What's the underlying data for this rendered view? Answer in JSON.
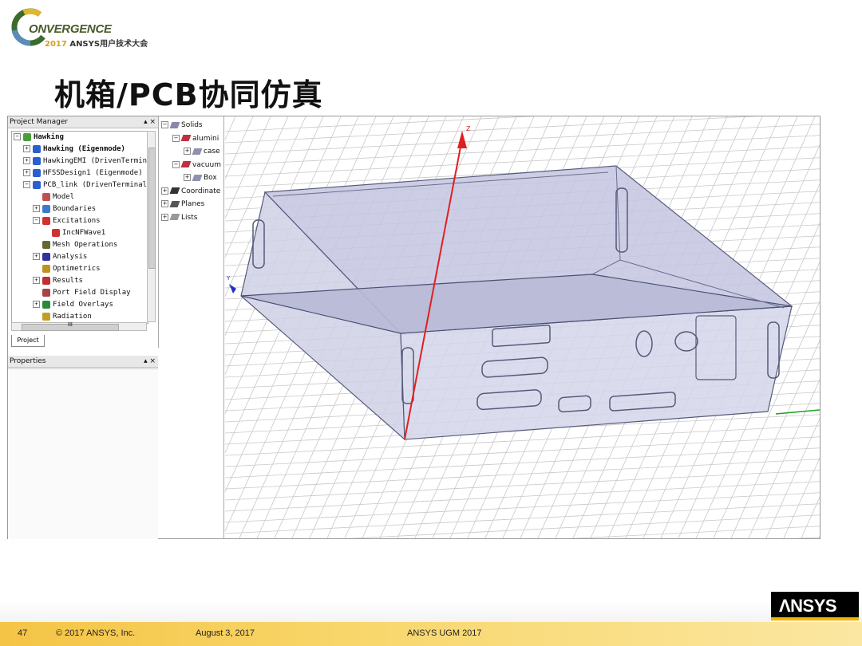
{
  "logo": {
    "word": "ONVERGENCE",
    "year": "2017",
    "event": " ANSYS用户技术大会"
  },
  "slide": {
    "title": "机箱/PCB协同仿真"
  },
  "project_manager": {
    "title": "Project Manager",
    "controls": "▴ ×",
    "tree": [
      {
        "label": "Hawking",
        "indent": 0,
        "bold": true,
        "expander": "−",
        "icon": "project-icon",
        "color": "#4a9e3a"
      },
      {
        "label": "Hawking (Eigenmode)",
        "indent": 1,
        "bold": true,
        "expander": "+",
        "icon": "hfss-design-icon",
        "color": "#2b5fd0"
      },
      {
        "label": "HawkingEMI (DrivenTerminal)",
        "indent": 1,
        "bold": false,
        "expander": "+",
        "icon": "hfss-design-icon",
        "color": "#2b5fd0"
      },
      {
        "label": "HFSSDesign1 (Eigenmode)",
        "indent": 1,
        "bold": false,
        "expander": "+",
        "icon": "hfss-design-icon",
        "color": "#2b5fd0"
      },
      {
        "label": "PCB_link (DrivenTerminal)",
        "indent": 1,
        "bold": false,
        "expander": "−",
        "icon": "hfss-design-icon",
        "color": "#2b5fd0"
      },
      {
        "label": "Model",
        "indent": 2,
        "bold": false,
        "expander": "",
        "icon": "model-icon",
        "color": "#c05050"
      },
      {
        "label": "Boundaries",
        "indent": 2,
        "bold": false,
        "expander": "+",
        "icon": "boundaries-icon",
        "color": "#3a7ad0"
      },
      {
        "label": "Excitations",
        "indent": 2,
        "bold": false,
        "expander": "−",
        "icon": "excitations-icon",
        "color": "#d03030"
      },
      {
        "label": "IncNFWave1",
        "indent": 3,
        "bold": false,
        "expander": "",
        "icon": "wave-icon",
        "color": "#d03030"
      },
      {
        "label": "Mesh Operations",
        "indent": 2,
        "bold": false,
        "expander": "",
        "icon": "mesh-icon",
        "color": "#666633"
      },
      {
        "label": "Analysis",
        "indent": 2,
        "bold": false,
        "expander": "+",
        "icon": "analysis-icon",
        "color": "#333399"
      },
      {
        "label": "Optimetrics",
        "indent": 2,
        "bold": false,
        "expander": "",
        "icon": "optimetrics-icon",
        "color": "#c09020"
      },
      {
        "label": "Results",
        "indent": 2,
        "bold": false,
        "expander": "+",
        "icon": "results-icon",
        "color": "#c03030"
      },
      {
        "label": "Port Field Display",
        "indent": 2,
        "bold": false,
        "expander": "",
        "icon": "port-field-icon",
        "color": "#aa4444"
      },
      {
        "label": "Field Overlays",
        "indent": 2,
        "bold": false,
        "expander": "+",
        "icon": "field-overlays-icon",
        "color": "#2a8a3a"
      },
      {
        "label": "Radiation",
        "indent": 2,
        "bold": false,
        "expander": "",
        "icon": "radiation-icon",
        "color": "#c0a020"
      }
    ],
    "hscroll_label": "III",
    "tab": "Project"
  },
  "properties": {
    "title": "Properties",
    "controls": "▴ ×"
  },
  "model_tree": [
    {
      "label": "Solids",
      "indent": 0,
      "expander": "−",
      "icon": "solids-icon"
    },
    {
      "label": "alumini",
      "indent": 1,
      "expander": "−",
      "icon": "material-icon"
    },
    {
      "label": "case",
      "indent": 2,
      "expander": "+",
      "icon": "object-icon"
    },
    {
      "label": "vacuum",
      "indent": 1,
      "expander": "−",
      "icon": "material-icon"
    },
    {
      "label": "Box",
      "indent": 2,
      "expander": "+",
      "icon": "object-icon"
    },
    {
      "label": "Coordinate",
      "indent": 0,
      "expander": "+",
      "icon": "coordinate-icon"
    },
    {
      "label": "Planes",
      "indent": 0,
      "expander": "+",
      "icon": "planes-icon"
    },
    {
      "label": "Lists",
      "indent": 0,
      "expander": "+",
      "icon": "lists-icon"
    }
  ],
  "viewport": {
    "axis_z": "Z",
    "axis_y": "Y",
    "grid_color": "#c8c8c8",
    "box_fill": "#b8bcd8",
    "z_color": "#e02020",
    "y_color": "#2030c0",
    "x_color": "#20a020"
  },
  "footer": {
    "page": "47",
    "copyright": "© 2017 ANSYS, Inc.",
    "date": "August 3, 2017",
    "event": "ANSYS UGM 2017",
    "brand": "ΛNSYS"
  }
}
